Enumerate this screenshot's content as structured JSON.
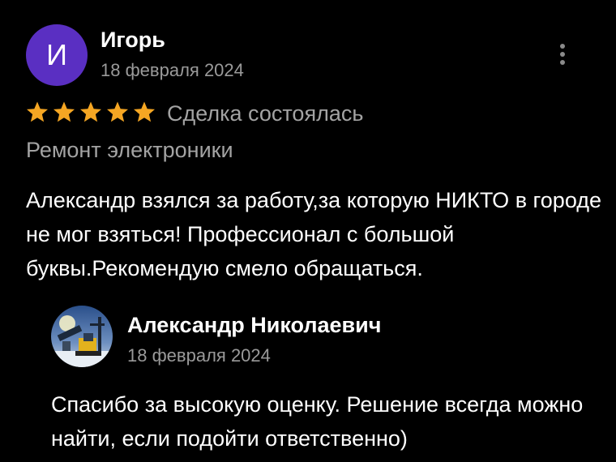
{
  "review": {
    "author": {
      "initial": "И",
      "name": "Игорь",
      "date": "18 февраля 2024",
      "avatar_color": "#5a2fc2"
    },
    "rating": 5,
    "star_color": "#f5a623",
    "deal_status": "Сделка состоялась",
    "category": "Ремонт электроники",
    "text": "Александр взялся за работу,за которую НИКТО в городе не мог взяться! Профессионал с большой буквы.Рекомендую смело обращаться."
  },
  "reply": {
    "name": "Александр Николаевич",
    "date": "18 февраля 2024",
    "text": "Спасибо за высокую оценку. Решение всегда можно найти, если подойти ответственно)"
  },
  "icons": {
    "more": "more-vertical-icon",
    "star": "star-icon"
  }
}
